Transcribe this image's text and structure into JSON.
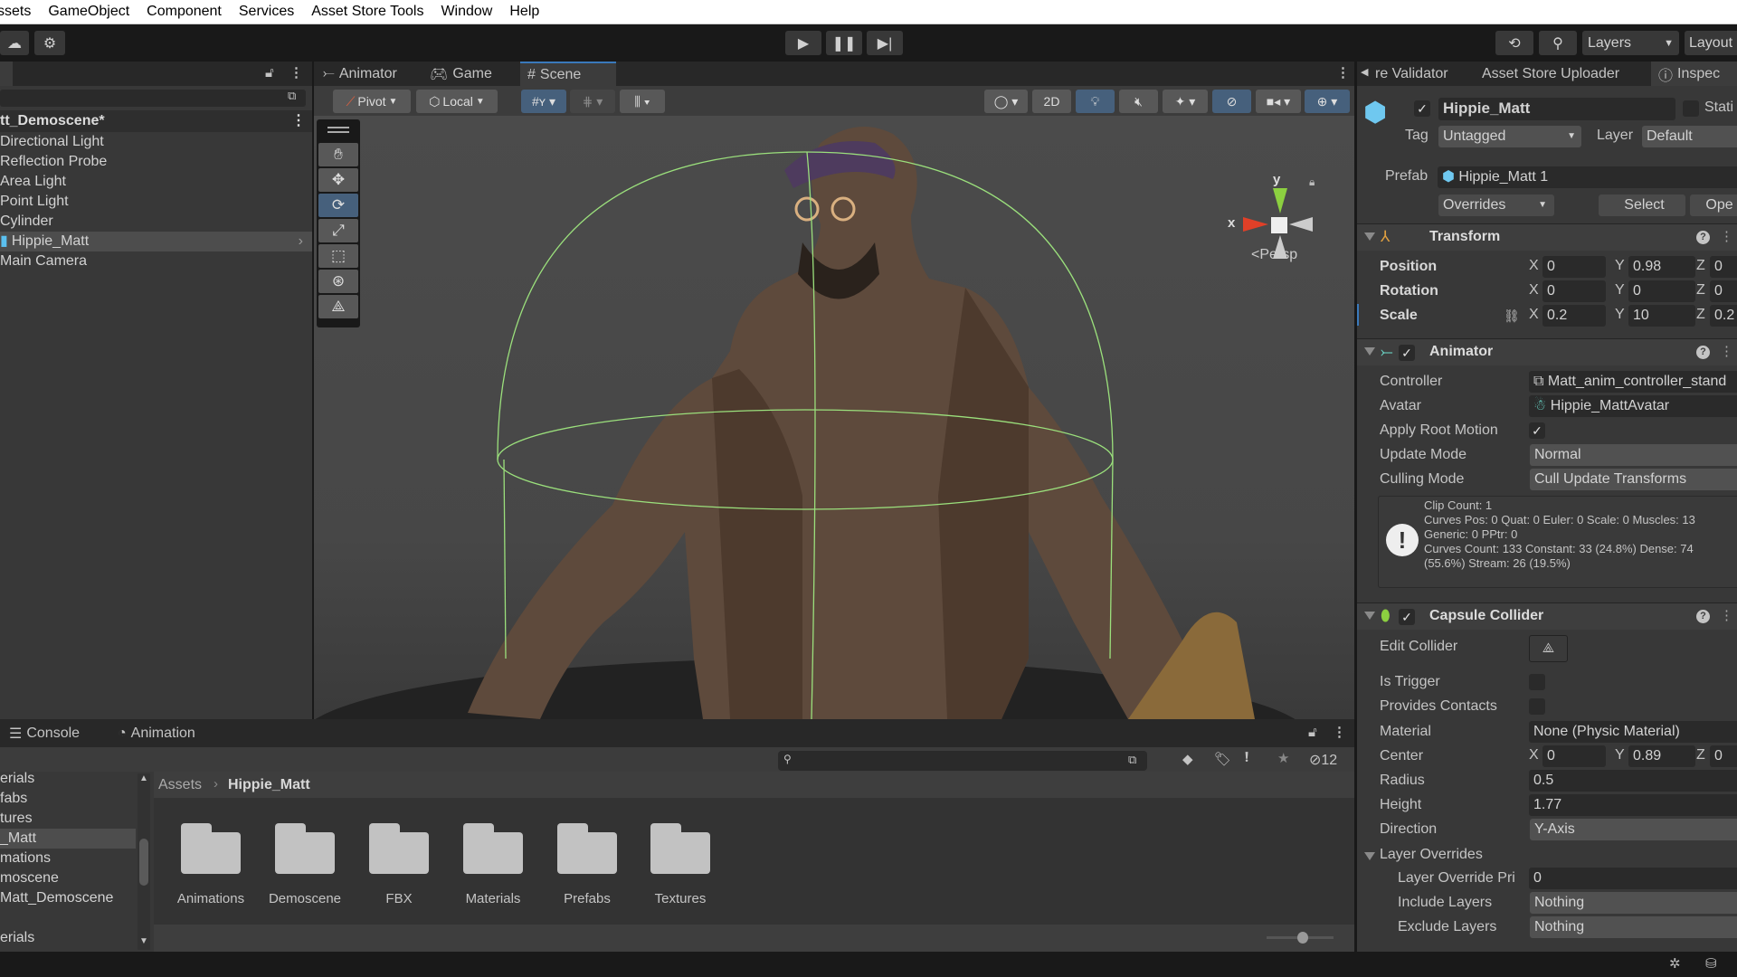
{
  "menu": [
    "ssets",
    "GameObject",
    "Component",
    "Services",
    "Asset Store Tools",
    "Window",
    "Help"
  ],
  "toolbar": {
    "layers_label": "Layers",
    "layout_label": "Layout"
  },
  "hierarchy": {
    "scene_name": "tt_Demoscene*",
    "items": [
      "Directional Light",
      "Reflection Probe",
      "Area Light",
      "Point Light",
      "Cylinder",
      "Hippie_Matt",
      "Main Camera"
    ],
    "selected_index": 5
  },
  "scene_tabs": {
    "animator": "Animator",
    "game": "Game",
    "scene": "Scene"
  },
  "scene_toolbar": {
    "pivot": "Pivot",
    "local": "Local",
    "mode_2d": "2D"
  },
  "scene_view": {
    "persp_label": "Persp",
    "axis_x": "x",
    "axis_y": "y"
  },
  "inspector": {
    "tabs": [
      "re Validator",
      "Asset Store Uploader",
      "Inspec"
    ],
    "object_name": "Hippie_Matt",
    "static_label": "Stati",
    "tag_label": "Tag",
    "tag_value": "Untagged",
    "layer_label": "Layer",
    "layer_value": "Default",
    "prefab_label": "Prefab",
    "prefab_value": "Hippie_Matt 1",
    "overrides": "Overrides",
    "select": "Select",
    "open": "Ope",
    "transform": {
      "title": "Transform",
      "rows": [
        {
          "label": "Position",
          "x": "0",
          "y": "0.98",
          "z": "0"
        },
        {
          "label": "Rotation",
          "x": "0",
          "y": "0",
          "z": "0"
        },
        {
          "label": "Scale",
          "x": "0.2",
          "y": "10",
          "z": "0.2"
        }
      ],
      "axes": [
        "X",
        "Y",
        "Z"
      ]
    },
    "animator": {
      "title": "Animator",
      "controller_label": "Controller",
      "controller_value": "Matt_anim_controller_stand",
      "avatar_label": "Avatar",
      "avatar_value": "Hippie_MattAvatar",
      "apply_root_motion_label": "Apply Root Motion",
      "apply_root_motion": true,
      "update_mode_label": "Update Mode",
      "update_mode": "Normal",
      "culling_mode_label": "Culling Mode",
      "culling_mode": "Cull Update Transforms",
      "info": [
        "Clip Count: 1",
        "Curves Pos: 0 Quat: 0 Euler: 0 Scale: 0 Muscles: 13",
        "Generic: 0 PPtr: 0",
        "Curves Count: 133 Constant: 33 (24.8%) Dense: 74",
        "(55.6%) Stream: 26 (19.5%)"
      ]
    },
    "capsule": {
      "title": "Capsule Collider",
      "edit_collider_label": "Edit Collider",
      "is_trigger_label": "Is Trigger",
      "provides_contacts_label": "Provides Contacts",
      "material_label": "Material",
      "material_value": "None (Physic Material)",
      "center_label": "Center",
      "center": {
        "x": "0",
        "y": "0.89",
        "z": "0"
      },
      "radius_label": "Radius",
      "radius": "0.5",
      "height_label": "Height",
      "height": "1.77",
      "direction_label": "Direction",
      "direction": "Y-Axis",
      "layer_overrides_label": "Layer Overrides",
      "lop_label": "Layer Override Pri",
      "lop_value": "0",
      "include_label": "Include Layers",
      "include_value": "Nothing",
      "exclude_label": "Exclude Layers",
      "exclude_value": "Nothing"
    }
  },
  "bottom": {
    "tabs": [
      "Console",
      "Animation"
    ],
    "hidden_count": "12",
    "breadcrumb": [
      "Assets",
      "Hippie_Matt"
    ],
    "tree": [
      "erials",
      "fabs",
      "tures",
      "_Matt",
      "mations",
      "moscene",
      "Matt_Demoscene",
      "",
      "erials"
    ],
    "tree_selected_index": 3,
    "folders": [
      "Animations",
      "Demoscene",
      "FBX",
      "Materials",
      "Prefabs",
      "Textures"
    ]
  },
  "colors": {
    "accent": "#3a79bb",
    "selected_button": "#46607c",
    "gizmo_green": "#9be07c"
  }
}
